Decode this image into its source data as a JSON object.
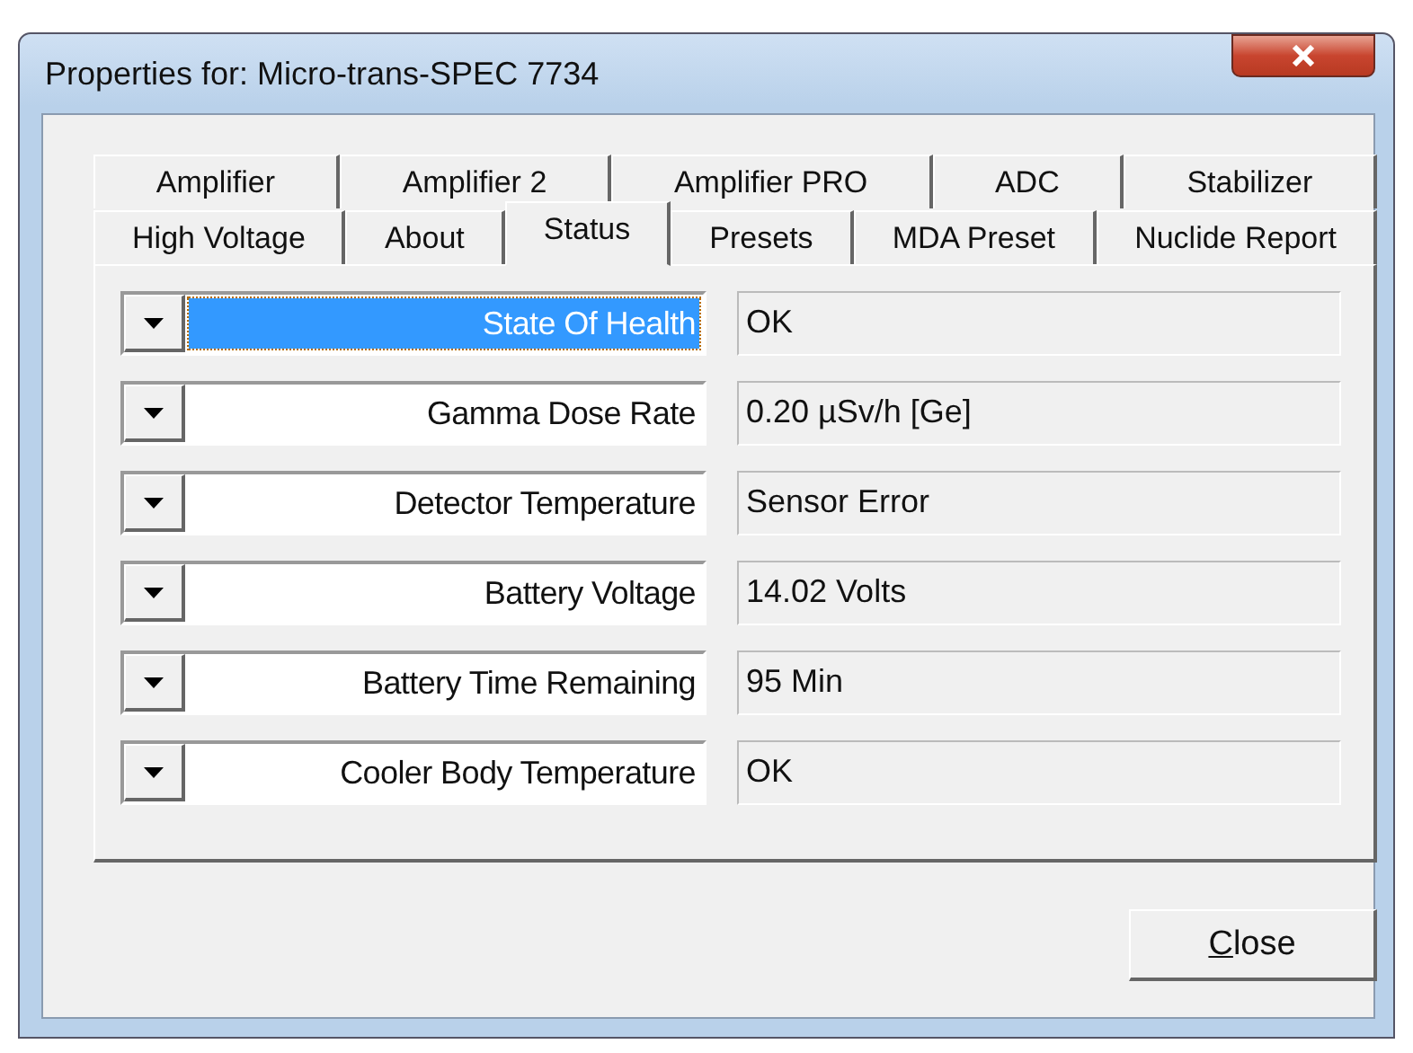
{
  "window": {
    "title": "Properties for: Micro-trans-SPEC 7734"
  },
  "tab_rows": [
    [
      {
        "label": "Amplifier",
        "selected": false
      },
      {
        "label": "Amplifier 2",
        "selected": false
      },
      {
        "label": "Amplifier PRO",
        "selected": false
      },
      {
        "label": "ADC",
        "selected": false
      },
      {
        "label": "Stabilizer",
        "selected": false
      }
    ],
    [
      {
        "label": "High Voltage",
        "selected": false
      },
      {
        "label": "About",
        "selected": false
      },
      {
        "label": "Status",
        "selected": true
      },
      {
        "label": "Presets",
        "selected": false
      },
      {
        "label": "MDA Preset",
        "selected": false
      },
      {
        "label": "Nuclide Report",
        "selected": false
      }
    ]
  ],
  "status_rows": [
    {
      "label": "State Of Health",
      "value": "OK",
      "selected": true
    },
    {
      "label": "Gamma Dose Rate",
      "value": "0.20 µSv/h [Ge]",
      "selected": false
    },
    {
      "label": "Detector Temperature",
      "value": "Sensor Error",
      "selected": false
    },
    {
      "label": "Battery Voltage",
      "value": "14.02 Volts",
      "selected": false
    },
    {
      "label": "Battery Time Remaining",
      "value": "95 Min",
      "selected": false
    },
    {
      "label": "Cooler Body Temperature",
      "value": "OK",
      "selected": false
    }
  ],
  "buttons": [
    {
      "label": "Close",
      "access_key_underlined": true
    }
  ]
}
